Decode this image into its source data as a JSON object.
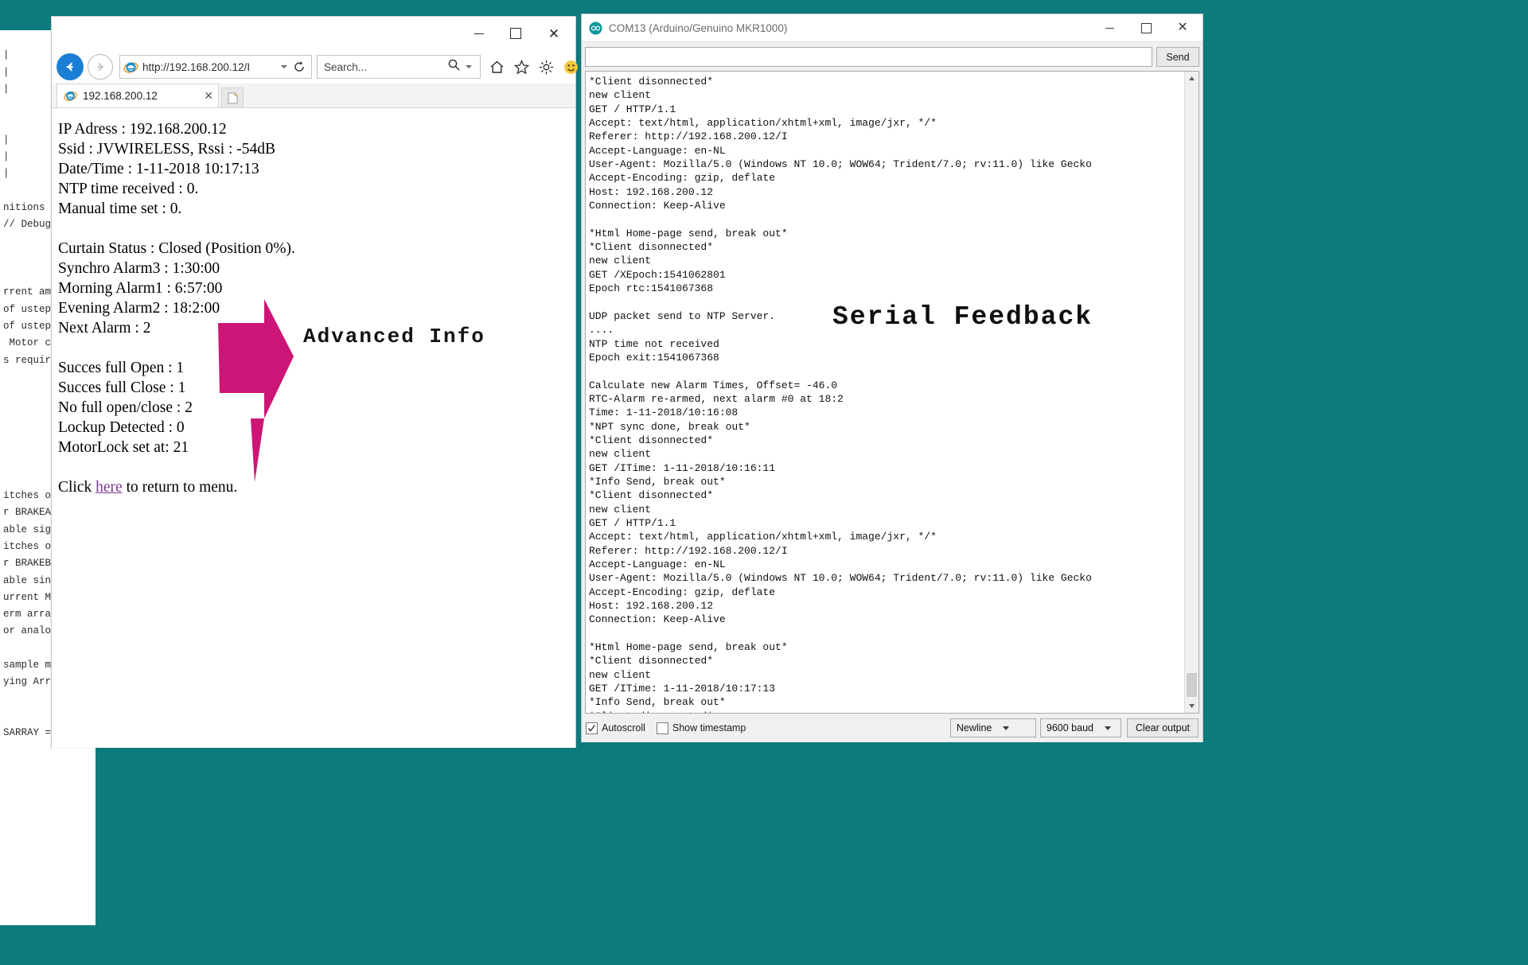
{
  "desktop": {
    "background_color": "#0d7b7e",
    "code_lines": [
      "",
      "|",
      "|",
      "|",
      "",
      "",
      "|",
      "|",
      "|",
      "",
      "nitions",
      "// Debug",
      "",
      "",
      "",
      "rrent am",
      "of ustep",
      "of usteps",
      " Motor c",
      "s requir",
      "",
      "",
      "",
      "",
      "",
      "",
      "",
      "itches o",
      "r BRAKEA",
      "able sig",
      "itches o",
      "r BRAKEB",
      "able sin",
      "urrent M",
      "erm arra",
      "or analo",
      "",
      "sample m",
      "ying Arr",
      "",
      "",
      "SARRAY ="
    ]
  },
  "browser": {
    "title_buttons": {
      "minimize": "minimize-icon",
      "maximize": "maximize-icon",
      "close": "✕"
    },
    "back_icon": "back-arrow-icon",
    "forward_icon": "forward-arrow-icon",
    "address_url": "http://192.168.200.12/I",
    "address_icon": "ie-logo-icon",
    "refresh_icon": "refresh-icon",
    "search_placeholder": "Search...",
    "search_icon": "magnifier-icon",
    "toolbar_icons": [
      "home-icon",
      "favorites-star-icon",
      "gear-icon",
      "smiley-icon"
    ],
    "tab": {
      "title": "192.168.200.12",
      "icon": "ie-logo-icon",
      "close": "✕"
    },
    "new_tab_icon": "new-tab-icon",
    "page": {
      "lines": [
        "IP Adress : 192.168.200.12",
        "Ssid : JVWIRELESS, Rssi : -54dB",
        "Date/Time : 1-11-2018 10:17:13",
        "NTP time received : 0.",
        "Manual time set : 0.",
        "",
        "Curtain Status : Closed (Position 0%).",
        "Synchro Alarm3 : 1:30:00",
        "Morning Alarm1 : 6:57:00",
        "Evening Alarm2 : 18:2:00",
        "Next Alarm : 2",
        "",
        "Succes full Open : 1",
        "Succes full Close : 1",
        "No full open/close : 2",
        "Lockup Detected : 0",
        "MotorLock set at: 21",
        ""
      ],
      "footer_prefix": "Click ",
      "footer_link": "here",
      "footer_suffix": " to return to menu.",
      "link_color": "#7a3a8f"
    }
  },
  "annotations": {
    "arrow_color": "#cc1577",
    "advanced_info_label": "Advanced Info",
    "serial_feedback_label": "Serial Feedback"
  },
  "serial_monitor": {
    "title": "COM13 (Arduino/Genuino MKR1000)",
    "logo_icon": "arduino-infinity-icon",
    "title_buttons": {
      "minimize": "minimize-icon",
      "maximize": "maximize-icon",
      "close": "✕"
    },
    "input_value": "",
    "send_label": "Send",
    "log": "*Client disonnected*\nnew client\nGET / HTTP/1.1\nAccept: text/html, application/xhtml+xml, image/jxr, */*\nReferer: http://192.168.200.12/I\nAccept-Language: en-NL\nUser-Agent: Mozilla/5.0 (Windows NT 10.0; WOW64; Trident/7.0; rv:11.0) like Gecko\nAccept-Encoding: gzip, deflate\nHost: 192.168.200.12\nConnection: Keep-Alive\n\n*Html Home-page send, break out*\n*Client disonnected*\nnew client\nGET /XEpoch:1541062801\nEpoch rtc:1541067368\n\nUDP packet send to NTP Server.\n....\nNTP time not received\nEpoch exit:1541067368\n\nCalculate new Alarm Times, Offset= -46.0\nRTC-Alarm re-armed, next alarm #0 at 18:2\nTime: 1-11-2018/10:16:08\n*NPT sync done, break out*\n*Client disonnected*\nnew client\nGET /ITime: 1-11-2018/10:16:11\n*Info Send, break out*\n*Client disonnected*\nnew client\nGET / HTTP/1.1\nAccept: text/html, application/xhtml+xml, image/jxr, */*\nReferer: http://192.168.200.12/I\nAccept-Language: en-NL\nUser-Agent: Mozilla/5.0 (Windows NT 10.0; WOW64; Trident/7.0; rv:11.0) like Gecko\nAccept-Encoding: gzip, deflate\nHost: 192.168.200.12\nConnection: Keep-Alive\n\n*Html Home-page send, break out*\n*Client disonnected*\nnew client\nGET /ITime: 1-11-2018/10:17:13\n*Info Send, break out*\n*Client disonnected*",
    "autoscroll_label": "Autoscroll",
    "autoscroll_checked": true,
    "show_timestamp_label": "Show timestamp",
    "show_timestamp_checked": false,
    "line_ending": "Newline",
    "baud_rate": "9600 baud",
    "clear_output_label": "Clear output"
  }
}
